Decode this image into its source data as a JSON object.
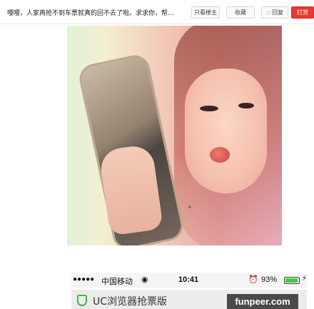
{
  "header": {
    "title": "嘤嘤，人家再抢不到车票就真的回不去了啦。求求你，帮...",
    "only_op_label": "只看楼主",
    "favorite_label": "收藏",
    "reply_icon": "○",
    "reply_label": "回复",
    "reward_label": "打赏"
  },
  "photo": {
    "icon": "selfie-photo"
  },
  "status_bar": {
    "signal": "●●●●●",
    "carrier": "中国移动",
    "wifi": "◉",
    "time": "10:41",
    "alarm": "⏰",
    "battery_percent": "93%",
    "battery_level": 0.93,
    "charging": "⚡"
  },
  "uc_bar": {
    "title": "UC浏览器抢票版"
  },
  "watermark": {
    "text": "funpeer.com"
  },
  "colors": {
    "reward_button": "#e53935",
    "battery_fill": "#3ecc3e",
    "shield": "#4caf50"
  }
}
